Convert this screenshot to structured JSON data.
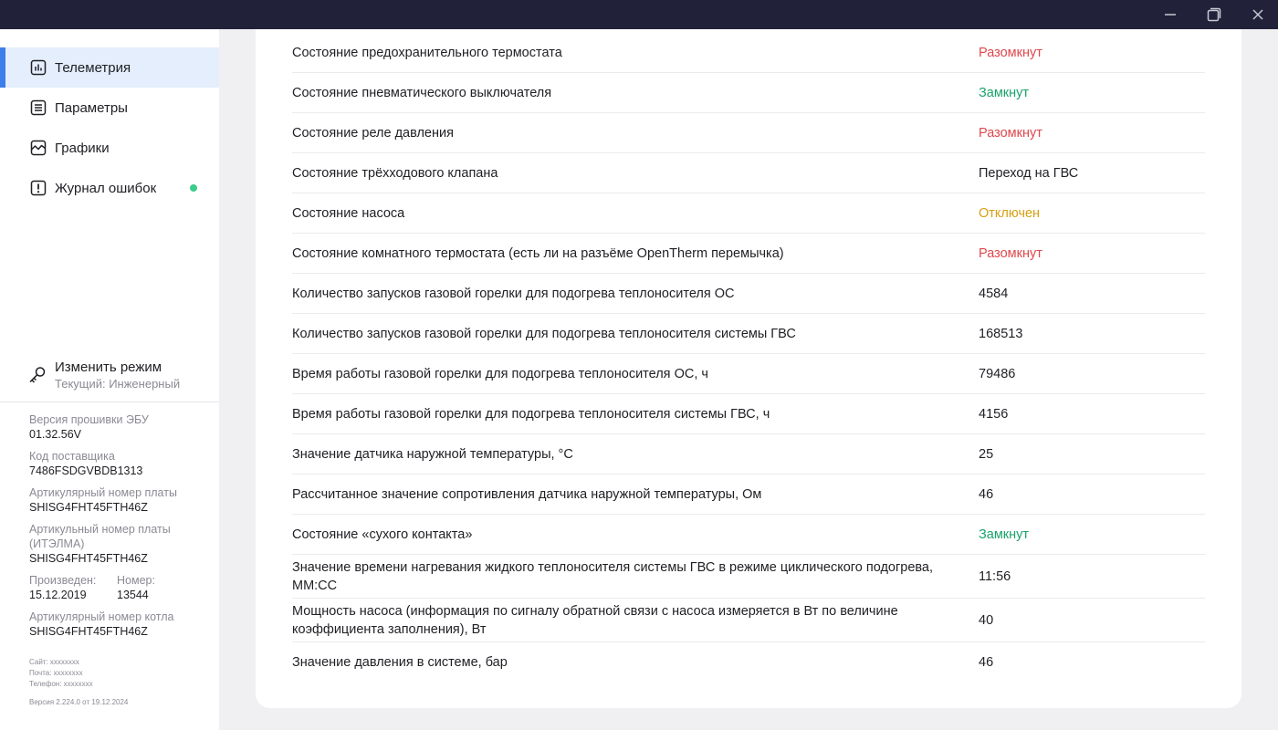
{
  "colors": {
    "accent": "#3d7fe8",
    "active_bg": "#e4eefc",
    "status_red": "#e0474c",
    "status_green": "#1aa36b",
    "status_yellow": "#d6a012",
    "dot": "#3ecb8c",
    "titlebar": "#21223a"
  },
  "window": {
    "controls": [
      "minimize-icon",
      "restore-icon",
      "close-icon"
    ]
  },
  "sidebar": {
    "items": [
      {
        "label": "Телеметрия",
        "icon": "bar-chart-icon",
        "active": true
      },
      {
        "label": "Параметры",
        "icon": "list-icon",
        "active": false
      },
      {
        "label": "Графики",
        "icon": "line-chart-icon",
        "active": false
      },
      {
        "label": "Журнал ошибок",
        "icon": "alert-icon",
        "active": false,
        "has_dot": true
      }
    ],
    "mode": {
      "title": "Изменить режим",
      "current": "Текущий: Инженерный",
      "icon": "key-icon"
    },
    "info": {
      "firmware_label": "Версия прошивки ЭБУ",
      "firmware_value": "01.32.56V",
      "vendor_label": "Код поставщика",
      "vendor_value": "7486FSDGVBDB1313",
      "board_article_label": "Артикулярный номер платы",
      "board_article_value": "SHISG4FHT45FTH46Z",
      "board_article_itelma_label_1": "Артикульный номер платы",
      "board_article_itelma_label_2": "(ИТЭЛМА)",
      "board_article_itelma_value": "SHISG4FHT45FTH46Z",
      "produced_label": "Произведен:",
      "produced_value": "15.12.2019",
      "number_label": "Номер:",
      "number_value": "13544",
      "boiler_article_label": "Артикулярный номер котла",
      "boiler_article_value": "SHISG4FHT45FTH46Z"
    },
    "footer": {
      "site": "Сайт: xxxxxxxx",
      "mail": "Почта: xxxxxxxx",
      "phone": "Телефон: xxxxxxxx",
      "version": "Версия 2.224.0 от 19.12.2024"
    }
  },
  "telemetry": [
    {
      "label": "Состояние предохранительного термостата",
      "value": "Разомкнут",
      "status": "red"
    },
    {
      "label": "Состояние пневматического выключателя",
      "value": "Замкнут",
      "status": "green"
    },
    {
      "label": "Состояние реле давления",
      "value": "Разомкнут",
      "status": "red"
    },
    {
      "label": "Состояние трёхходового клапана",
      "value": "Переход на ГВС",
      "status": "normal"
    },
    {
      "label": "Состояние насоса",
      "value": "Отключен",
      "status": "yellow"
    },
    {
      "label": "Состояние комнатного термостата (есть ли на разъёме OpenTherm перемычка)",
      "value": "Разомкнут",
      "status": "red"
    },
    {
      "label": "Количество запусков газовой горелки для подогрева теплоносителя ОС",
      "value": "4584",
      "status": "normal"
    },
    {
      "label": "Количество запусков газовой горелки для подогрева теплоносителя системы ГВС",
      "value": "168513",
      "status": "normal"
    },
    {
      "label": "Время работы газовой горелки для подогрева теплоносителя ОС, ч",
      "value": "79486",
      "status": "normal"
    },
    {
      "label": "Время работы газовой горелки для подогрева теплоносителя системы ГВС, ч",
      "value": "4156",
      "status": "normal"
    },
    {
      "label": "Значение датчика наружной температуры, °С",
      "value": "25",
      "status": "normal"
    },
    {
      "label": "Рассчитанное значение сопротивления датчика наружной температуры, Ом",
      "value": "46",
      "status": "normal"
    },
    {
      "label": "Состояние «сухого контакта»",
      "value": "Замкнут",
      "status": "green"
    },
    {
      "label": "Значение времени нагревания жидкого теплоносителя системы ГВС в режиме циклического подогрева, ММ:СС",
      "value": "11:56",
      "status": "normal"
    },
    {
      "label": "Мощность насоса (информация по сигналу обратной связи с насоса измеряется в Вт по величине коэффициента заполнения), Вт",
      "value": "40",
      "status": "normal"
    },
    {
      "label": "Значение давления в системе, бар",
      "value": "46",
      "status": "normal"
    }
  ]
}
